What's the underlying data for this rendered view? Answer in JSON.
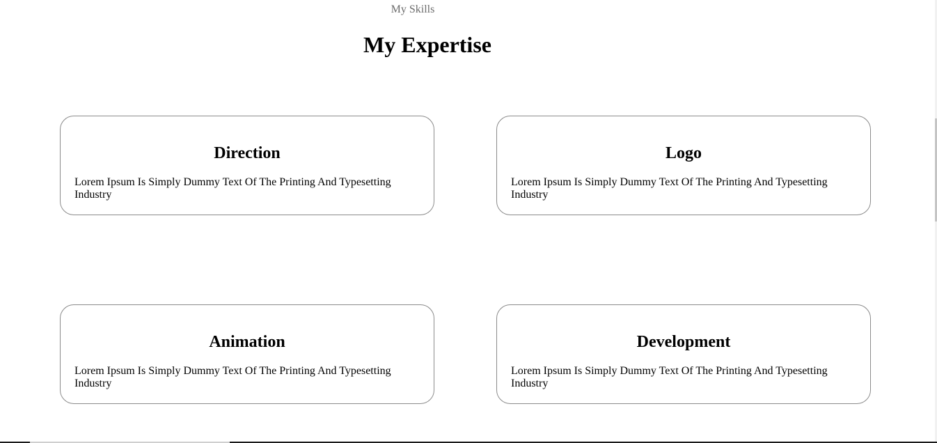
{
  "section": {
    "eyebrow": "My Skills",
    "heading": "My Expertise"
  },
  "cards": [
    {
      "title": "Direction",
      "text": "Lorem Ipsum Is Simply Dummy Text Of The Printing And Typesetting Industry"
    },
    {
      "title": "Logo",
      "text": "Lorem Ipsum Is Simply Dummy Text Of The Printing And Typesetting Industry"
    },
    {
      "title": "Animation",
      "text": "Lorem Ipsum Is Simply Dummy Text Of The Printing And Typesetting Industry"
    },
    {
      "title": "Development",
      "text": "Lorem Ipsum Is Simply Dummy Text Of The Printing And Typesetting Industry"
    }
  ]
}
